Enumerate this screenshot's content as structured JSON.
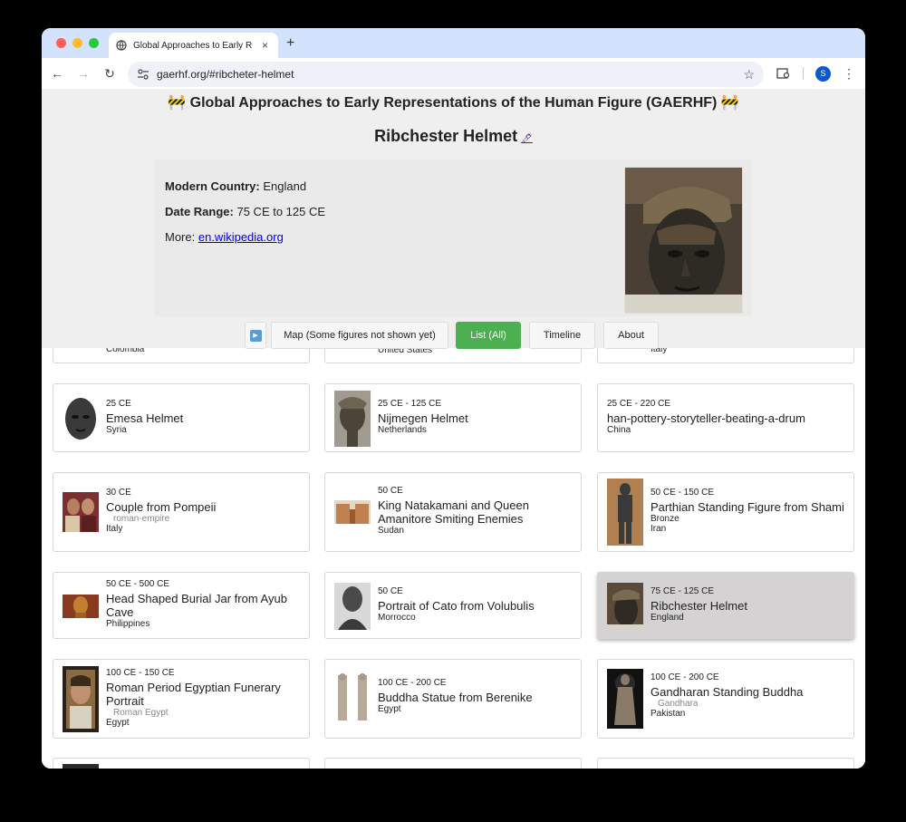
{
  "browser": {
    "tab_title": "Global Approaches to Early R",
    "url": "gaerhf.org/#ribcheter-helmet",
    "avatar_letter": "S"
  },
  "site": {
    "title": "🚧 Global Approaches to Early Representations of the Human Figure (GAERHF) 🚧"
  },
  "detail": {
    "title": "Ribchester Helmet",
    "edit_icon": "🖊",
    "country_label": "Modern Country:",
    "country": "England",
    "date_label": "Date Range:",
    "date": "75 CE to 125 CE",
    "more_label": "More:",
    "more_link": "en.wikipedia.org"
  },
  "buttons": {
    "play": "▶",
    "map": "Map (Some figures not shown yet)",
    "list": "List (All)",
    "timeline": "Timeline",
    "about": "About"
  },
  "partial_row": [
    "Colombia",
    "United States",
    "Italy"
  ],
  "cards": [
    {
      "date": "25 CE",
      "name": "Emesa Helmet",
      "sub": "",
      "country": "Syria"
    },
    {
      "date": "25 CE - 125 CE",
      "name": "Nijmegen Helmet",
      "sub": "",
      "country": "Netherlands"
    },
    {
      "date": "25 CE - 220 CE",
      "name": "han-pottery-storyteller-beating-a-drum",
      "sub": "",
      "country": "China"
    },
    {
      "date": "30 CE",
      "name": "Couple from Pompeii",
      "sub": "roman-empire",
      "country": "Italy"
    },
    {
      "date": "50 CE",
      "name": "King Natakamani and Queen Amanitore Smiting Enemies",
      "sub": "",
      "country": "Sudan"
    },
    {
      "date": "50 CE - 150 CE",
      "name": "Parthian Standing Figure from Shami",
      "sub": "",
      "material": "Bronze",
      "country": "Iran"
    },
    {
      "date": "50 CE - 500 CE",
      "name": "Head Shaped Burial Jar from Ayub Cave",
      "sub": "",
      "country": "Philippines"
    },
    {
      "date": "50 CE",
      "name": "Portrait of Cato from Volubulis",
      "sub": "",
      "country": "Morrocco"
    },
    {
      "date": "75 CE - 125 CE",
      "name": "Ribchester Helmet",
      "sub": "",
      "country": "England"
    },
    {
      "date": "100 CE - 150 CE",
      "name": "Roman Period Egyptian Funerary Portrait",
      "sub": "Roman Egypt",
      "country": "Egypt"
    },
    {
      "date": "100 CE - 200 CE",
      "name": "Buddha Statue from Berenike",
      "sub": "",
      "country": "Egypt"
    },
    {
      "date": "100 CE - 200 CE",
      "name": "Gandharan Standing Buddha",
      "sub": "Gandhara",
      "country": "Pakistan"
    }
  ]
}
